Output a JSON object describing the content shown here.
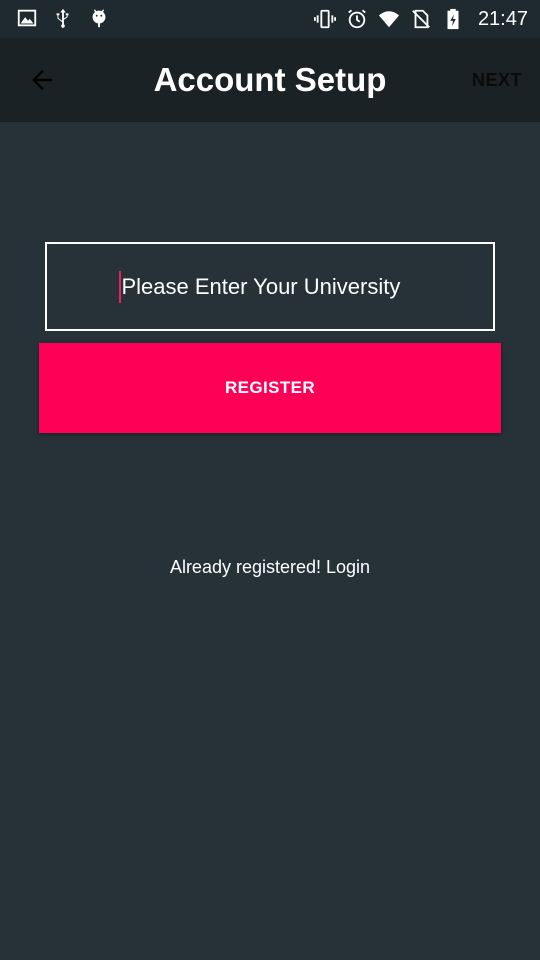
{
  "status_bar": {
    "left_icons": [
      "image-icon",
      "usb-icon",
      "android-debug-icon"
    ],
    "right_icons": [
      "vibrate-icon",
      "alarm-icon",
      "wifi-icon",
      "no-sim-icon",
      "battery-charging-icon"
    ],
    "time": "21:47"
  },
  "toolbar": {
    "back_icon": "arrow-left-icon",
    "title": "Account Setup",
    "next_label": "NEXT"
  },
  "form": {
    "university_placeholder": "Please Enter Your University",
    "university_value": "",
    "register_label": "REGISTER",
    "login_link": "Already registered! Login"
  },
  "colors": {
    "background": "#263238",
    "toolbar": "#1b2226",
    "accent": "#ff0057",
    "caret": "#e91e63"
  }
}
